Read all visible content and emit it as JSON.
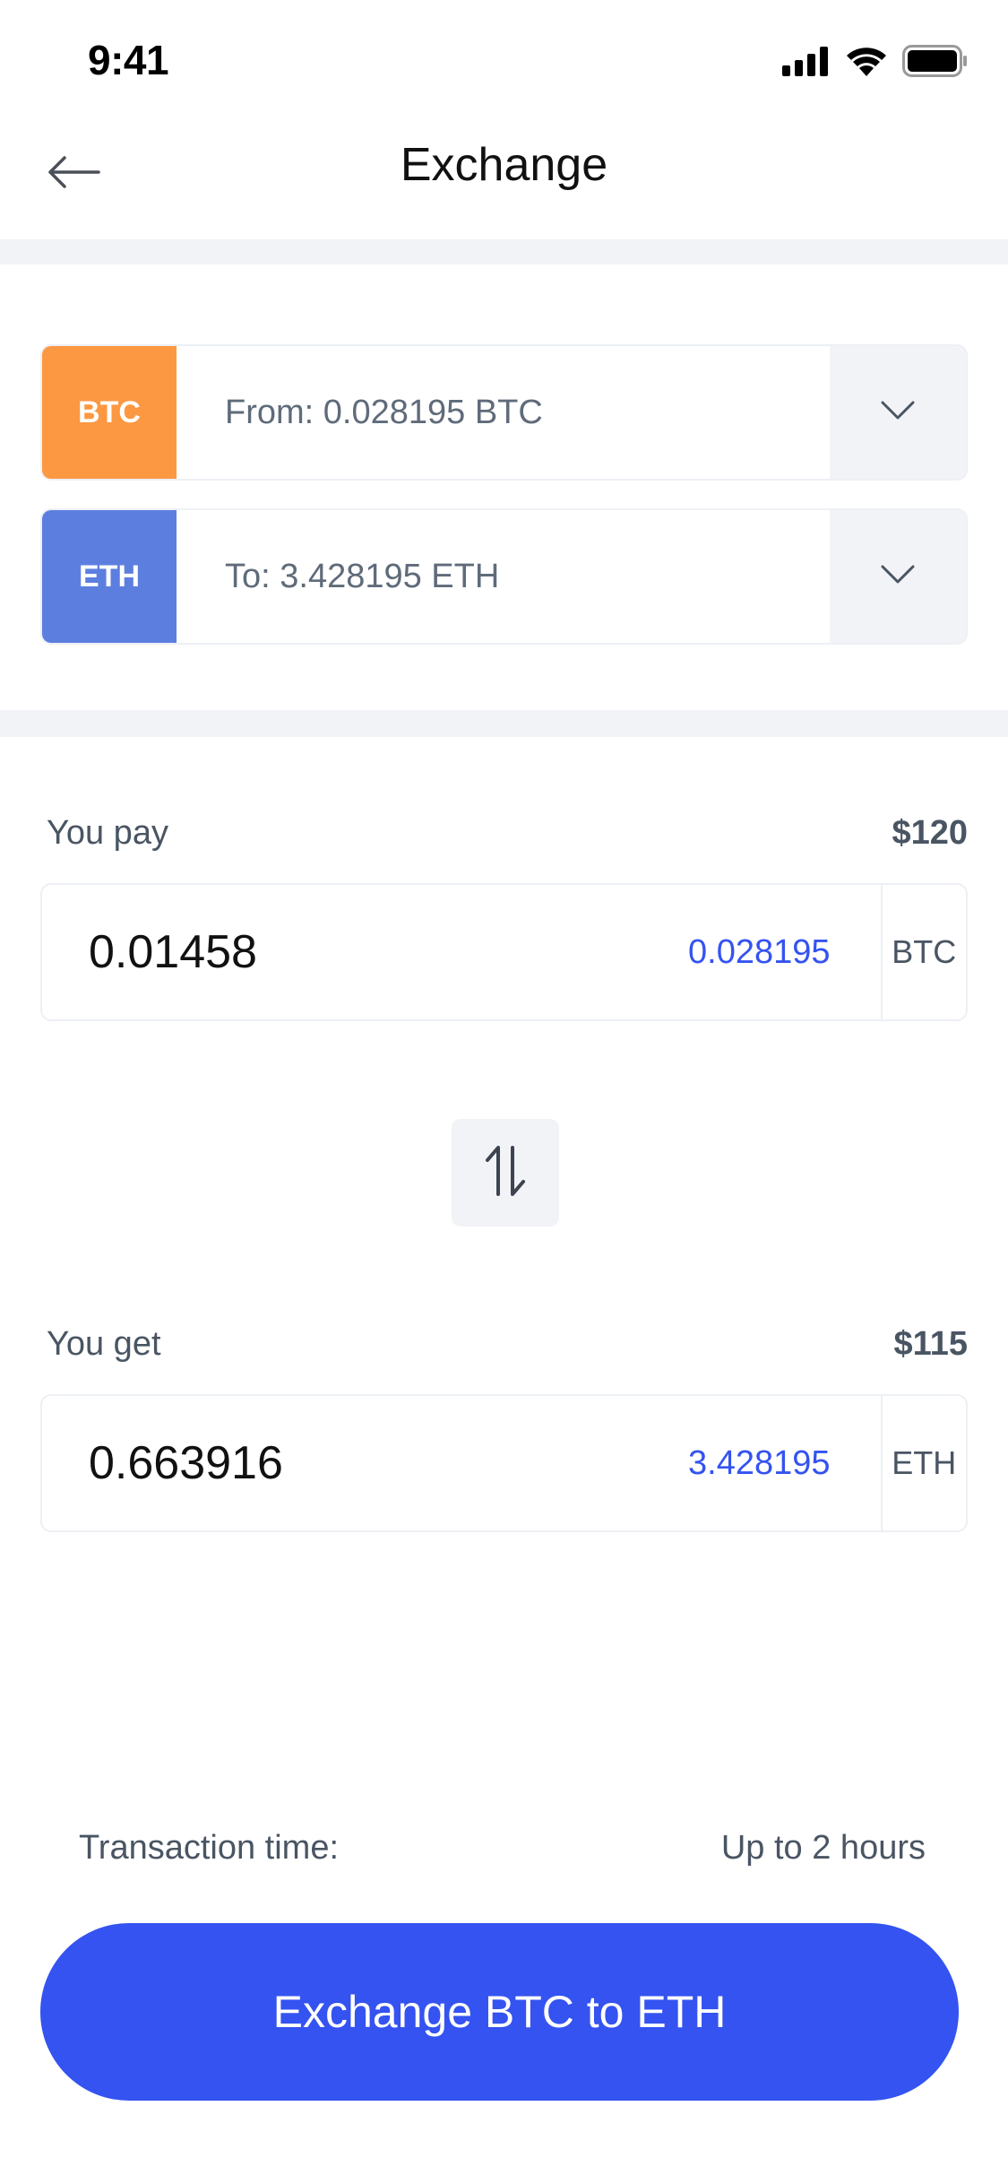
{
  "status_bar": {
    "time": "9:41",
    "icons": [
      "cellular-signal-icon",
      "wifi-icon",
      "battery-icon"
    ]
  },
  "nav": {
    "title": "Exchange",
    "back_icon": "arrow-left-icon"
  },
  "from_selector": {
    "coin": "BTC",
    "label": "From: 0.028195 BTC",
    "color": "#FC9841",
    "caret_icon": "chevron-down-icon"
  },
  "to_selector": {
    "coin": "ETH",
    "label": "To: 3.428195 ETH",
    "color": "#5C7FDF",
    "caret_icon": "chevron-down-icon"
  },
  "pay": {
    "label": "You pay",
    "usd": "$120",
    "amount": "0.01458",
    "balance": "0.028195",
    "currency": "BTC"
  },
  "swap": {
    "icon": "swap-vertical-icon"
  },
  "get": {
    "label": "You get",
    "usd": "$115",
    "amount": "0.663916",
    "balance": "3.428195",
    "currency": "ETH"
  },
  "transaction": {
    "label": "Transaction time:",
    "value": "Up to 2 hours"
  },
  "cta": {
    "label": "Exchange BTC to ETH"
  },
  "colors": {
    "accent": "#3453F0",
    "divider": "#F1F3F7",
    "border": "#EDF0F4"
  }
}
